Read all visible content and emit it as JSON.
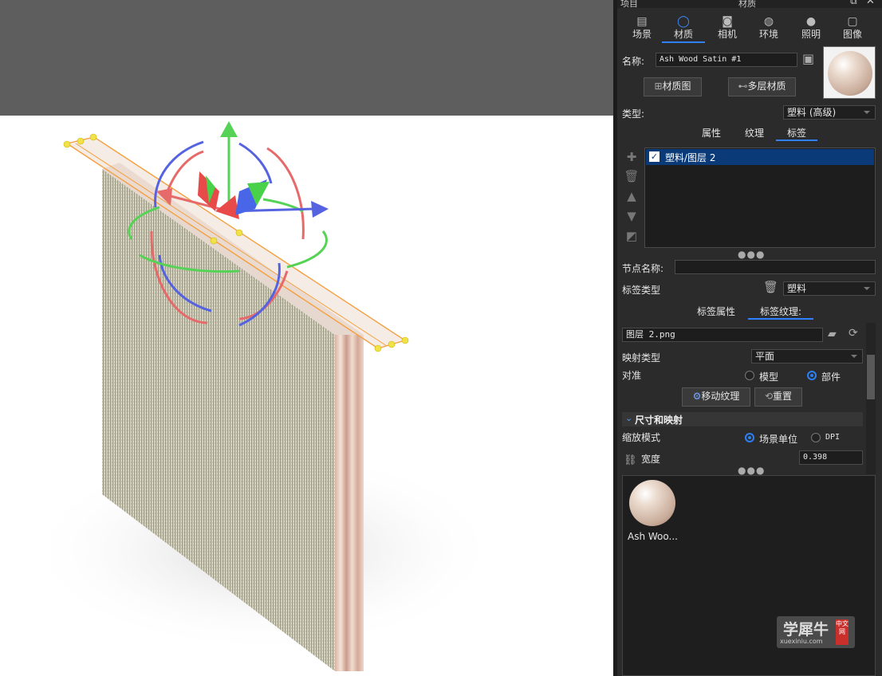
{
  "panel": {
    "header": {
      "left": "项目",
      "center": "材质"
    },
    "tabs": [
      {
        "label": "场景",
        "icon": "list-icon"
      },
      {
        "label": "材质",
        "icon": "sphere-icon"
      },
      {
        "label": "相机",
        "icon": "camera-icon"
      },
      {
        "label": "环境",
        "icon": "globe-icon"
      },
      {
        "label": "照明",
        "icon": "bulb-icon"
      },
      {
        "label": "图像",
        "icon": "frame-icon"
      }
    ],
    "name_label": "名称:",
    "name_value": "Ash Wood Satin #1",
    "material_graph_btn": "材质图",
    "multilayer_btn": "多层材质",
    "type_label": "类型:",
    "type_value": "塑料 (高级)",
    "subtabs": [
      "属性",
      "纹理",
      "标签"
    ],
    "label_item": "塑料/图层 2",
    "dots": "●●●",
    "node_name_label": "节点名称:",
    "label_type_label": "标签类型",
    "label_type_value": "塑料",
    "label_tabs": [
      "标签属性",
      "标签纹理:"
    ],
    "texture_file": "图层 2.png",
    "mapping_label": "映射类型",
    "mapping_value": "平面",
    "align_label": "对准",
    "align_opt_model": "模型",
    "align_opt_part": "部件",
    "move_texture_btn": "移动纹理",
    "reset_btn": "重置",
    "section_title": "尺寸和映射",
    "scale_mode_label": "缩放模式",
    "scale_opt_scene": "场景单位",
    "scale_opt_dpi": "DPI",
    "width_label": "宽度",
    "width_value": "0.398",
    "library_item": "Ash Woo...",
    "watermark_main": "学犀牛",
    "watermark_sub": "xuexiniu.com",
    "watermark_tag": "中文网"
  },
  "colors": {
    "accent": "#2f80ff",
    "selection": "#0a3a78",
    "panel_bg": "#2b2b2b",
    "viewport_top": "#5e5e5e",
    "viewport_canvas": "#ffffff"
  }
}
